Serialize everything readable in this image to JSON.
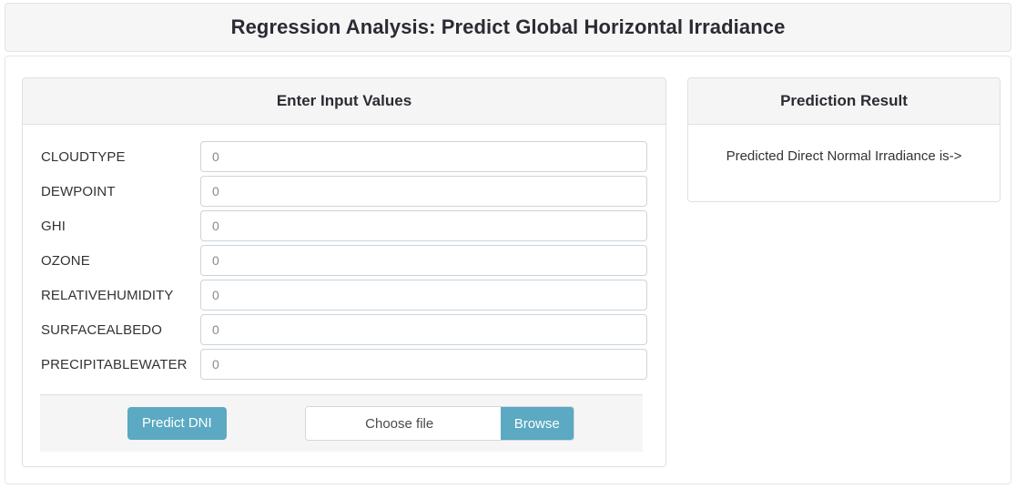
{
  "header": {
    "title": "Regression Analysis: Predict Global Horizontal Irradiance"
  },
  "form_panel": {
    "heading": "Enter Input Values",
    "fields": [
      {
        "label": "CLOUDTYPE",
        "value": "",
        "placeholder": "0"
      },
      {
        "label": "DEWPOINT",
        "value": "",
        "placeholder": "0"
      },
      {
        "label": "GHI",
        "value": "",
        "placeholder": "0"
      },
      {
        "label": "OZONE",
        "value": "",
        "placeholder": "0"
      },
      {
        "label": "RELATIVEHUMIDITY",
        "value": "",
        "placeholder": "0"
      },
      {
        "label": "SURFACEALBEDO",
        "value": "",
        "placeholder": "0"
      },
      {
        "label": "PRECIPITABLEWATER",
        "value": "",
        "placeholder": "0"
      }
    ],
    "footer": {
      "predict_label": "Predict DNI",
      "file_placeholder": "Choose file",
      "browse_label": "Browse"
    }
  },
  "result_panel": {
    "heading": "Prediction Result",
    "text": "Predicted Direct Normal Irradiance is->"
  },
  "colors": {
    "accent": "#5ba9c2",
    "panel_header_bg": "#f5f5f5",
    "border": "#e0e0e0",
    "text": "#333333"
  }
}
